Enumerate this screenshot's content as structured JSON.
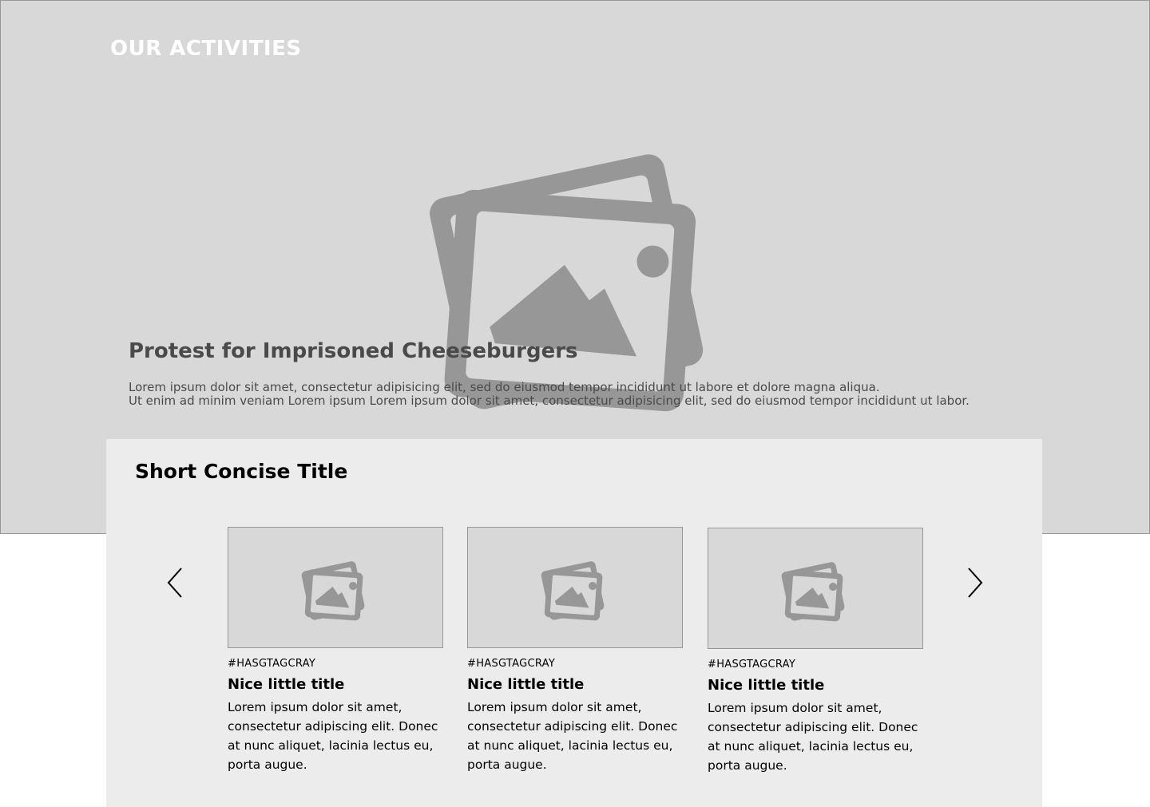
{
  "hero": {
    "section_label": "OUR ACTIVITIES",
    "image_icon": "photos-icon",
    "title": "Protest for Imprisoned Cheeseburgers",
    "description_lines": [
      "Lorem ipsum dolor sit amet, consectetur adipisicing elit, sed do eiusmod tempor incididunt ut labore et dolore magna aliqua.",
      "Ut enim ad minim veniam Lorem ipsum  Lorem ipsum dolor sit amet, consectetur adipisicing elit, sed do eiusmod tempor incididunt ut labor."
    ]
  },
  "carousel": {
    "title": "Short Concise Title",
    "prev_icon": "chevron-left-icon",
    "next_icon": "chevron-right-icon",
    "cards": [
      {
        "image_icon": "photos-icon",
        "tag": "#HASGTAGCRAY",
        "title": "Nice little title",
        "body": "Lorem ipsum dolor sit amet, consectetur adipiscing elit. Donec at nunc aliquet, lacinia lectus eu, porta augue."
      },
      {
        "image_icon": "photos-icon",
        "tag": "#HASGTAGCRAY",
        "title": "Nice little title",
        "body": "Lorem ipsum dolor sit amet, consectetur adipiscing elit. Donec at nunc aliquet, lacinia lectus eu, porta augue."
      },
      {
        "image_icon": "photos-icon",
        "tag": "#HASGTAGCRAY",
        "title": "Nice little title",
        "body": "Lorem ipsum dolor sit amet, consectetur adipiscing elit. Donec at nunc aliquet, lacinia lectus eu, porta augue."
      }
    ]
  },
  "colors": {
    "placeholder_bg": "#d8d8d8",
    "panel_bg": "#ececec",
    "icon_gray": "#979797",
    "hero_text": "#4a4a4a"
  }
}
